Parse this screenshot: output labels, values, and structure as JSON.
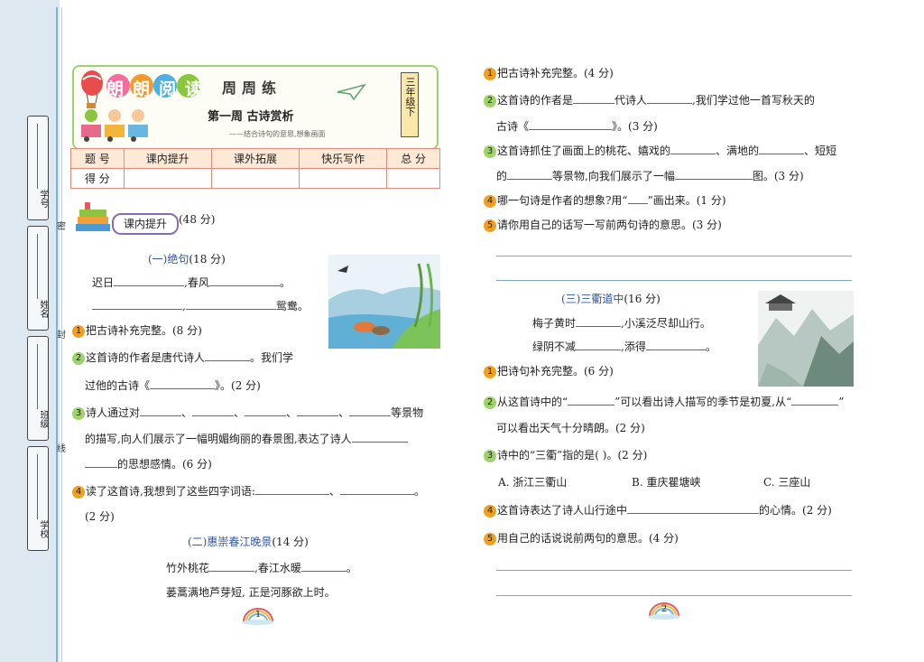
{
  "header": {
    "logo": "朗朗阅读",
    "series": "周周练",
    "week_title": "第一周   古诗赏析",
    "subtitle": "——结合诗句的意思,想象画面",
    "grade": "三年级下"
  },
  "sidebar": {
    "fields": [
      "学号",
      "姓名",
      "班级",
      "学校"
    ],
    "seal_chars": [
      "密",
      "封",
      "线"
    ]
  },
  "score_table": {
    "headers": [
      "题 号",
      "课内提升",
      "课外拓展",
      "快乐写作",
      "总 分"
    ],
    "row_label": "得 分"
  },
  "section": {
    "label": "课内提升",
    "points": "(48 分)"
  },
  "poem1": {
    "title": "(一)绝句",
    "points": "(18 分)",
    "line1_a": "迟日",
    "line1_b": ",春风",
    "line1_c": "。",
    "line2_a": ",",
    "line2_b": "鸳鸯。"
  },
  "q1": {
    "n1": "1",
    "t1": "把古诗补充完整。(8 分)",
    "n2": "2",
    "t2a": "这首诗的作者是唐代诗人",
    "t2b": "。我们学",
    "t2c": "过他的古诗《",
    "t2d": "》。(2 分)",
    "n3": "3",
    "t3a": "诗人通过对",
    "t3sep": "、",
    "t3b": "等景物",
    "t3c": "的描写,向人们展示了一幅明媚绚丽的春景图,表达了诗人",
    "t3d": "的思想感情。(6 分)",
    "n4": "4",
    "t4a": "读了这首诗,我想到了这些四字词语:",
    "t4sep": "、",
    "t4end": "。",
    "t4b": "(2 分)"
  },
  "poem2": {
    "title": "(二)惠崇春江晚景",
    "points": "(14 分)",
    "line1_a": "竹外桃花",
    "line1_b": ",春江水暖",
    "line1_c": "。",
    "line2": "蒌蒿满地芦芽短,   正是河豚欲上时。"
  },
  "q2": {
    "n1": "1",
    "t1": "把古诗补充完整。(4 分)",
    "n2": "2",
    "t2a": "这首诗的作者是",
    "t2b": "代诗人",
    "t2c": ",我们学过他一首写秋天的",
    "t2d": "古诗《",
    "t2e": "》。(3 分)",
    "n3": "3",
    "t3a": "这首诗抓住了画面上的桃花、嬉戏的",
    "t3b": "、满地的",
    "t3c": "、短短",
    "t3d": "的",
    "t3e": "等景物,向我们展示了一幅",
    "t3f": "图。(3 分)",
    "n4": "4",
    "t4a": "哪一句诗是作者的想象?用“",
    "t4b": "”画出来。(1 分)",
    "n5": "5",
    "t5": "请你用自己的话写一写前两句诗的意思。(3 分)"
  },
  "poem3": {
    "title": "(三)三衢道中",
    "points": "(16 分)",
    "line1_a": "梅子黄时",
    "line1_b": ",小溪泛尽却山行。",
    "line2_a": "绿阴不减",
    "line2_b": ",添得",
    "line2_c": "。"
  },
  "q3": {
    "n1": "1",
    "t1": "把诗句补充完整。(6 分)",
    "n2": "2",
    "t2a": "从这首诗中的“",
    "t2b": "”可以看出诗人描写的季节是初夏,从“",
    "t2c": "”",
    "t2d": "可以看出天气十分晴朗。(2 分)",
    "n3": "3",
    "t3": "诗中的“三衢”指的是(     )。(2 分)",
    "optA": "A. 浙江三衢山",
    "optB": "B. 重庆瞿塘峡",
    "optC": "C. 三座山",
    "n4": "4",
    "t4a": "这首诗表达了诗人山行途中",
    "t4b": "的心情。(2 分)",
    "n5": "5",
    "t5": "用自己的话说说前两句的意思。(4 分)"
  },
  "pages": {
    "left": "1",
    "right": "2"
  },
  "colors": {
    "accent_blue": "#2f56a8",
    "number_orange": "#f0a020",
    "table_border": "#e28b7c",
    "strip": "#dde8f1"
  }
}
